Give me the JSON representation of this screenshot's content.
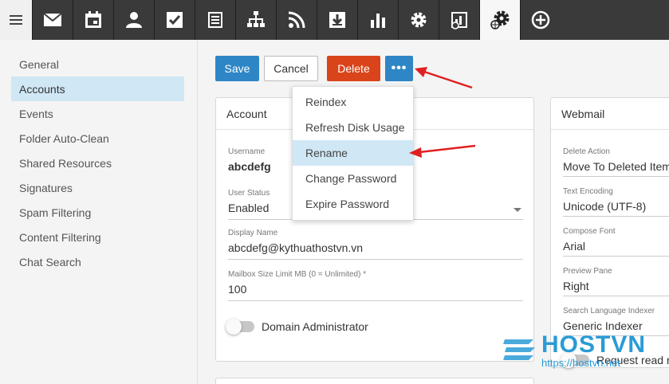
{
  "icons": {
    "hamburger": "menu-icon",
    "toolbar": [
      "email-icon",
      "calendar-icon",
      "contacts-icon",
      "tasks-icon",
      "notes-icon",
      "sitemap-icon",
      "rss-icon",
      "download-icon",
      "reports-icon",
      "settings-icon",
      "domain-reports-icon",
      "domain-settings-icon",
      "add-icon"
    ]
  },
  "sidebar": {
    "items": [
      {
        "label": "General"
      },
      {
        "label": "Accounts"
      },
      {
        "label": "Events"
      },
      {
        "label": "Folder Auto-Clean"
      },
      {
        "label": "Shared Resources"
      },
      {
        "label": "Signatures"
      },
      {
        "label": "Spam Filtering"
      },
      {
        "label": "Content Filtering"
      },
      {
        "label": "Chat Search"
      }
    ],
    "active_index": 1
  },
  "toolbar": {
    "save": "Save",
    "cancel": "Cancel",
    "delete": "Delete",
    "more": "•••"
  },
  "dropdown": {
    "items": [
      {
        "label": "Reindex"
      },
      {
        "label": "Refresh Disk Usage"
      },
      {
        "label": "Rename"
      },
      {
        "label": "Change Password"
      },
      {
        "label": "Expire Password"
      }
    ],
    "highlighted_index": 2
  },
  "account": {
    "title": "Account",
    "username_label": "Username",
    "username": "abcdefg",
    "status_label": "User Status",
    "status": "Enabled",
    "display_name_label": "Display Name",
    "display_name": "abcdefg@kythuathostvn.vn",
    "mailbox_label": "Mailbox Size Limit MB (0 = Unlimited) *",
    "mailbox": "100",
    "domain_admin_label": "Domain Administrator",
    "domain_admin_on": false
  },
  "webmail": {
    "title": "Webmail",
    "delete_action_label": "Delete Action",
    "delete_action": "Move To Deleted Items",
    "text_encoding_label": "Text Encoding",
    "text_encoding": "Unicode (UTF-8)",
    "compose_font_label": "Compose Font",
    "compose_font": "Arial",
    "preview_pane_label": "Preview Pane",
    "preview_pane": "Right",
    "search_indexer_label": "Search Language Indexer",
    "search_indexer": "Generic Indexer",
    "read_receipt_label": "Request read re"
  },
  "watermark": {
    "brand": "HOSTVN",
    "url": "https://hostvn.net"
  },
  "colors": {
    "primary": "#2f86c6",
    "danger": "#d9441a",
    "highlight": "#d0e7f5",
    "topbar": "#3a3a3a",
    "annotation_arrow": "#e02020"
  }
}
